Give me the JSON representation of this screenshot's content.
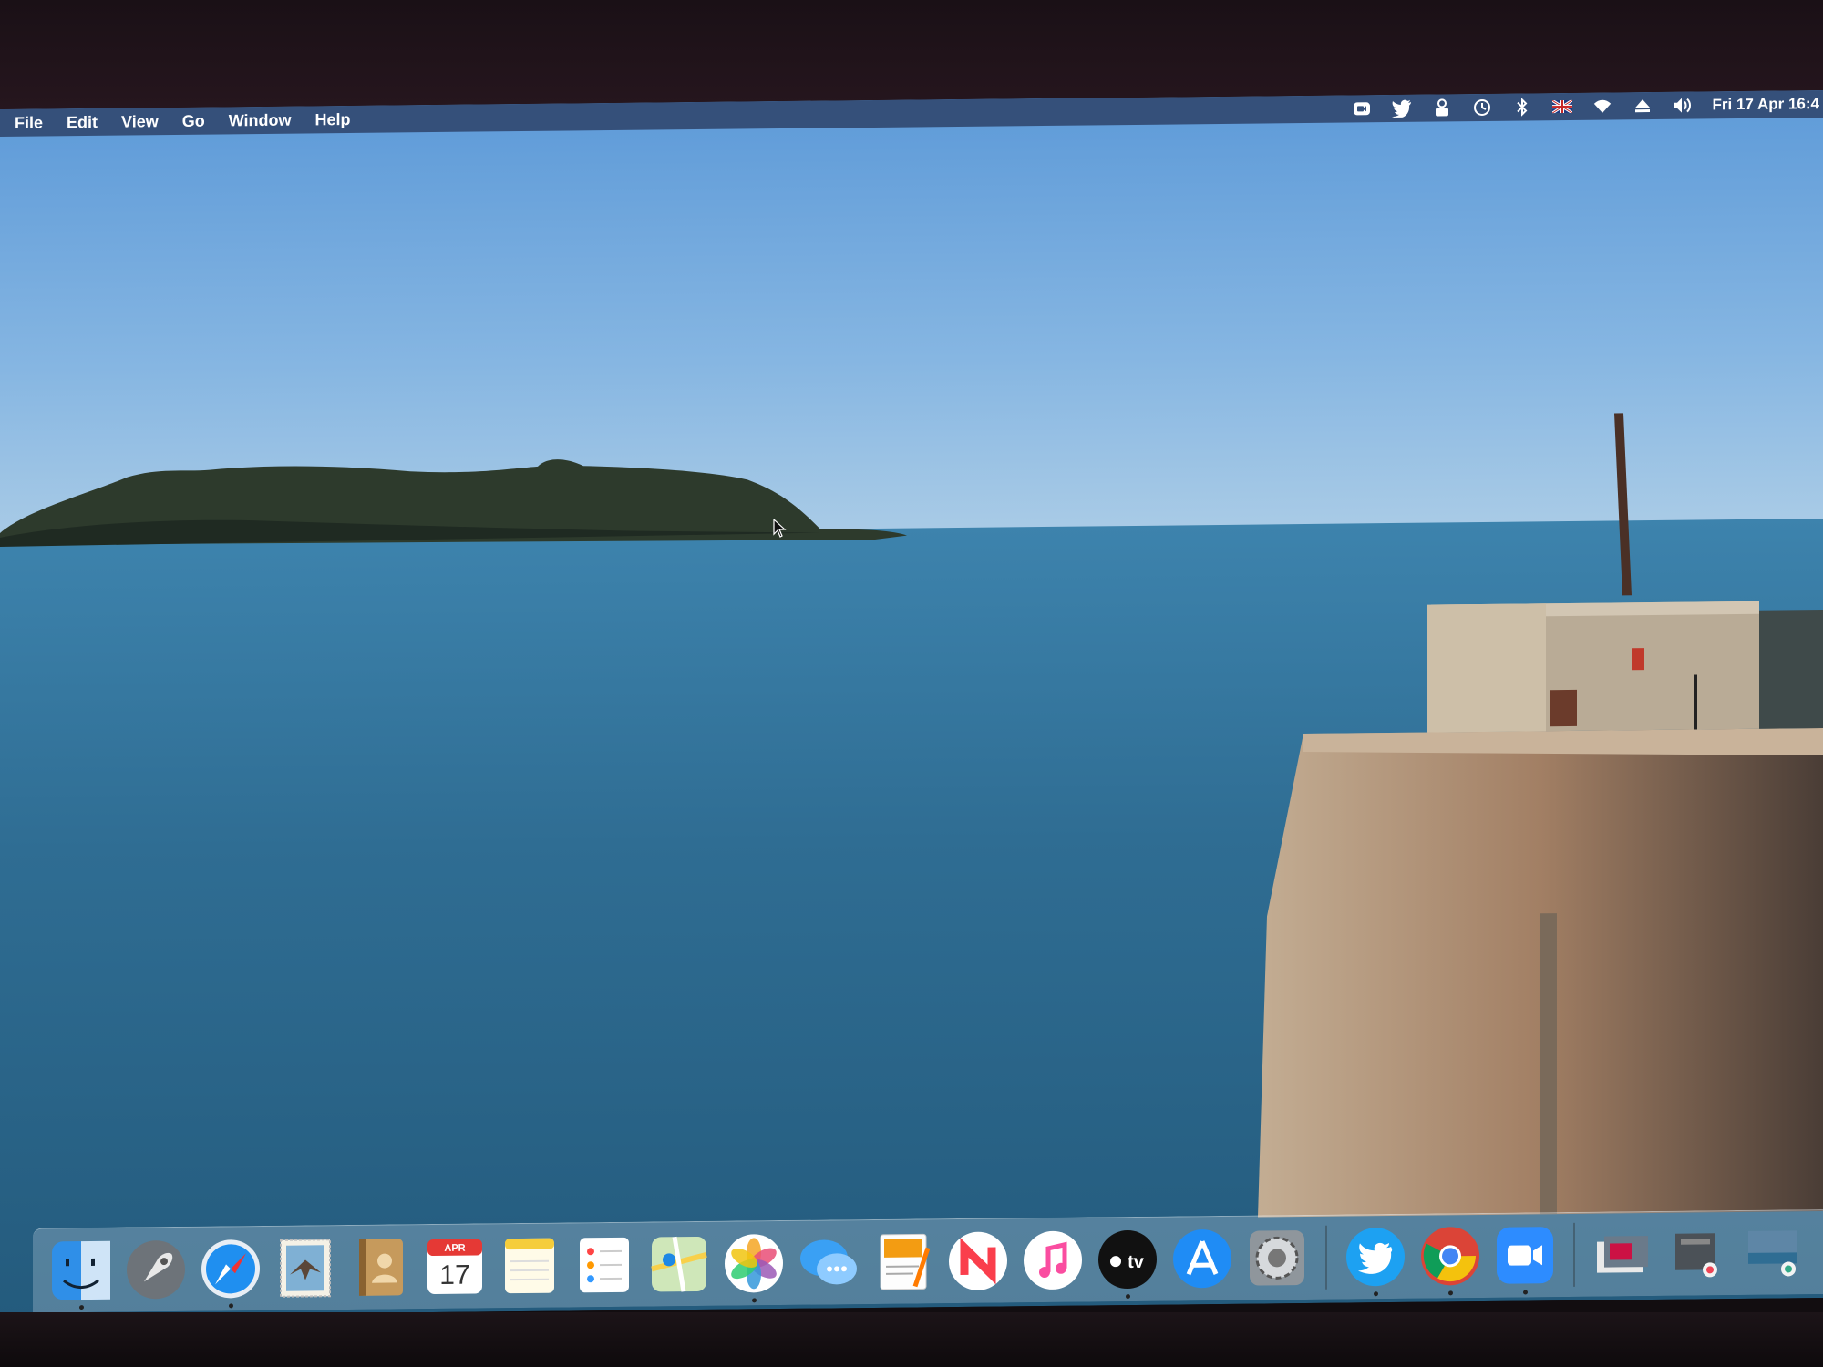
{
  "menubar": {
    "menus": [
      "File",
      "Edit",
      "View",
      "Go",
      "Window",
      "Help"
    ],
    "status_icons": [
      "zoom-icon",
      "twitter-icon",
      "user-lock-icon",
      "time-machine-icon",
      "bluetooth-icon",
      "uk-flag-icon",
      "wifi-icon",
      "eject-icon",
      "volume-icon"
    ],
    "clock": "Fri 17 Apr 16:4"
  },
  "dock": {
    "apps": [
      {
        "name": "Finder",
        "icon": "finder-icon",
        "running": true
      },
      {
        "name": "Launchpad",
        "icon": "rocket-icon",
        "running": false
      },
      {
        "name": "Safari",
        "icon": "compass-icon",
        "running": true
      },
      {
        "name": "Mail",
        "icon": "stamp-icon",
        "running": false
      },
      {
        "name": "Contacts",
        "icon": "contacts-book-icon",
        "running": false
      },
      {
        "name": "Calendar",
        "icon": "calendar-icon",
        "running": false,
        "month": "APR",
        "day": "17"
      },
      {
        "name": "Notes",
        "icon": "notepad-icon",
        "running": false
      },
      {
        "name": "Reminders",
        "icon": "checklist-icon",
        "running": false
      },
      {
        "name": "Maps",
        "icon": "map-icon",
        "running": false
      },
      {
        "name": "Photos",
        "icon": "photos-flower-icon",
        "running": true
      },
      {
        "name": "Messages",
        "icon": "chat-bubbles-icon",
        "running": false
      },
      {
        "name": "Pages",
        "icon": "pages-pen-icon",
        "running": false
      },
      {
        "name": "News",
        "icon": "news-icon",
        "running": false
      },
      {
        "name": "Music",
        "icon": "music-note-icon",
        "running": false
      },
      {
        "name": "TV",
        "icon": "apple-tv-icon",
        "running": true,
        "label": "tv"
      },
      {
        "name": "App Store",
        "icon": "app-store-icon",
        "running": false
      },
      {
        "name": "System Preferences",
        "icon": "gear-icon",
        "running": false
      }
    ],
    "pinned": [
      {
        "name": "Twitter",
        "icon": "twitter-bird-icon",
        "running": true
      },
      {
        "name": "Chrome",
        "icon": "chrome-icon",
        "running": true
      },
      {
        "name": "Zoom",
        "icon": "zoom-camera-icon",
        "running": true
      }
    ],
    "stacks": [
      {
        "name": "Documents stack",
        "icon": "documents-stack-icon"
      },
      {
        "name": "Downloads stack",
        "icon": "downloads-stack-icon"
      },
      {
        "name": "Desktop stack",
        "icon": "desktop-stack-icon"
      }
    ]
  },
  "colors": {
    "menubar": "#35507a",
    "sky_top": "#5d9ad8",
    "sky_horizon": "#a9cbe6",
    "sea": "#2f6d93",
    "pier_stone": "#a88a70"
  }
}
